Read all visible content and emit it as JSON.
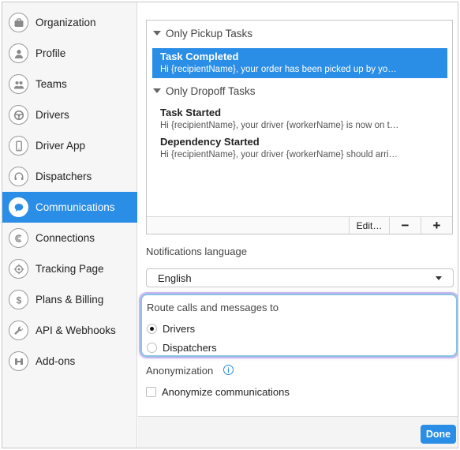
{
  "sidebar": {
    "items": [
      {
        "label": "Organization",
        "icon": "briefcase-icon"
      },
      {
        "label": "Profile",
        "icon": "user-icon"
      },
      {
        "label": "Teams",
        "icon": "team-icon"
      },
      {
        "label": "Drivers",
        "icon": "steering-wheel-icon"
      },
      {
        "label": "Driver App",
        "icon": "phone-icon"
      },
      {
        "label": "Dispatchers",
        "icon": "headset-icon"
      },
      {
        "label": "Communications",
        "icon": "chat-bubble-icon",
        "active": true
      },
      {
        "label": "Connections",
        "icon": "connection-icon"
      },
      {
        "label": "Tracking Page",
        "icon": "target-icon"
      },
      {
        "label": "Plans & Billing",
        "icon": "dollar-icon"
      },
      {
        "label": "API & Webhooks",
        "icon": "wrench-icon"
      },
      {
        "label": "Add-ons",
        "icon": "puzzle-icon"
      }
    ]
  },
  "tasks": {
    "groups": [
      {
        "header": "Only Pickup Tasks",
        "rows": [
          {
            "title": "Task Completed",
            "subtitle": "Hi {recipientName}, your order has been picked up by yo…",
            "selected": true
          }
        ]
      },
      {
        "header": "Only Dropoff Tasks",
        "rows": [
          {
            "title": "Task Started",
            "subtitle": "Hi {recipientName}, your driver {workerName} is now on t…"
          },
          {
            "title": "Dependency Started",
            "subtitle": "Hi {recipientName}, your driver {workerName} should arri…"
          }
        ]
      }
    ],
    "toolbar": {
      "edit_label": "Edit…",
      "remove_label": "−",
      "add_label": "+"
    }
  },
  "notifications": {
    "label": "Notifications language",
    "selected_language": "English"
  },
  "route": {
    "label": "Route calls and messages to",
    "options": [
      {
        "label": "Drivers",
        "checked": true
      },
      {
        "label": "Dispatchers",
        "checked": false
      }
    ]
  },
  "anonymization": {
    "label": "Anonymization",
    "info_glyph": "i",
    "checkbox_label": "Anonymize communications",
    "checked": false
  },
  "footer": {
    "done_label": "Done"
  },
  "colors": {
    "accent": "#2a8de6",
    "sidebar_bg": "#f6f6f6",
    "focus_ring": "#89c2e3"
  }
}
